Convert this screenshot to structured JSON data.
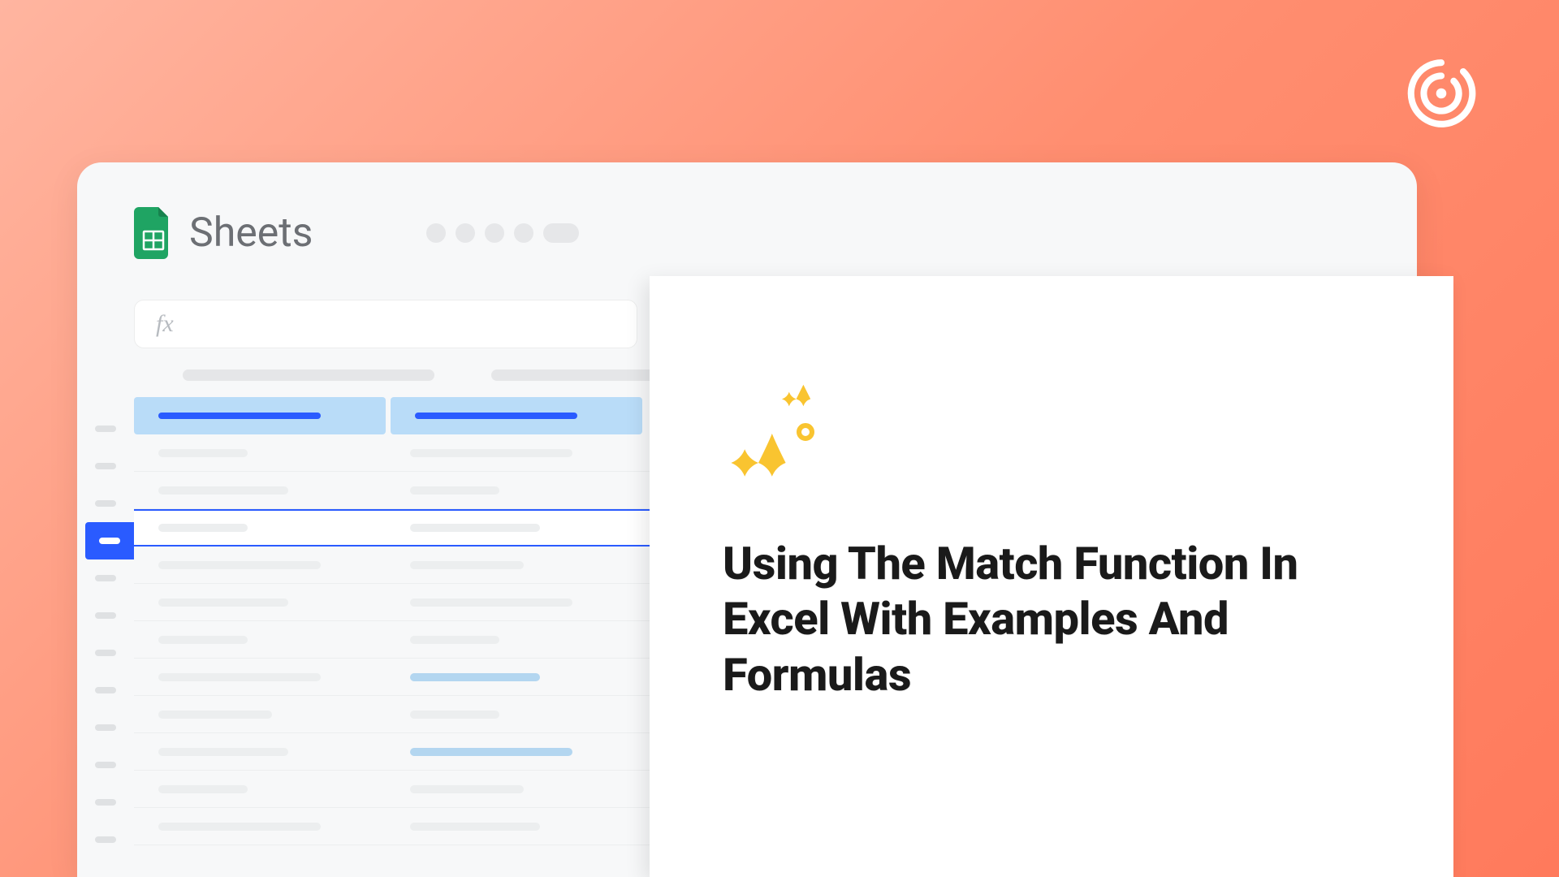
{
  "app": {
    "name": "Sheets",
    "fx_label": "fx"
  },
  "article": {
    "title": "Using The Match Function In Excel With Examples And Formulas"
  },
  "icons": {
    "logo": "concentric-c",
    "sheets": "google-sheets",
    "sparkle": "sparkle-star"
  },
  "colors": {
    "accent_blue": "#2a5bff",
    "header_cell": "#b9dcf8",
    "sparkle": "#f9c430"
  }
}
